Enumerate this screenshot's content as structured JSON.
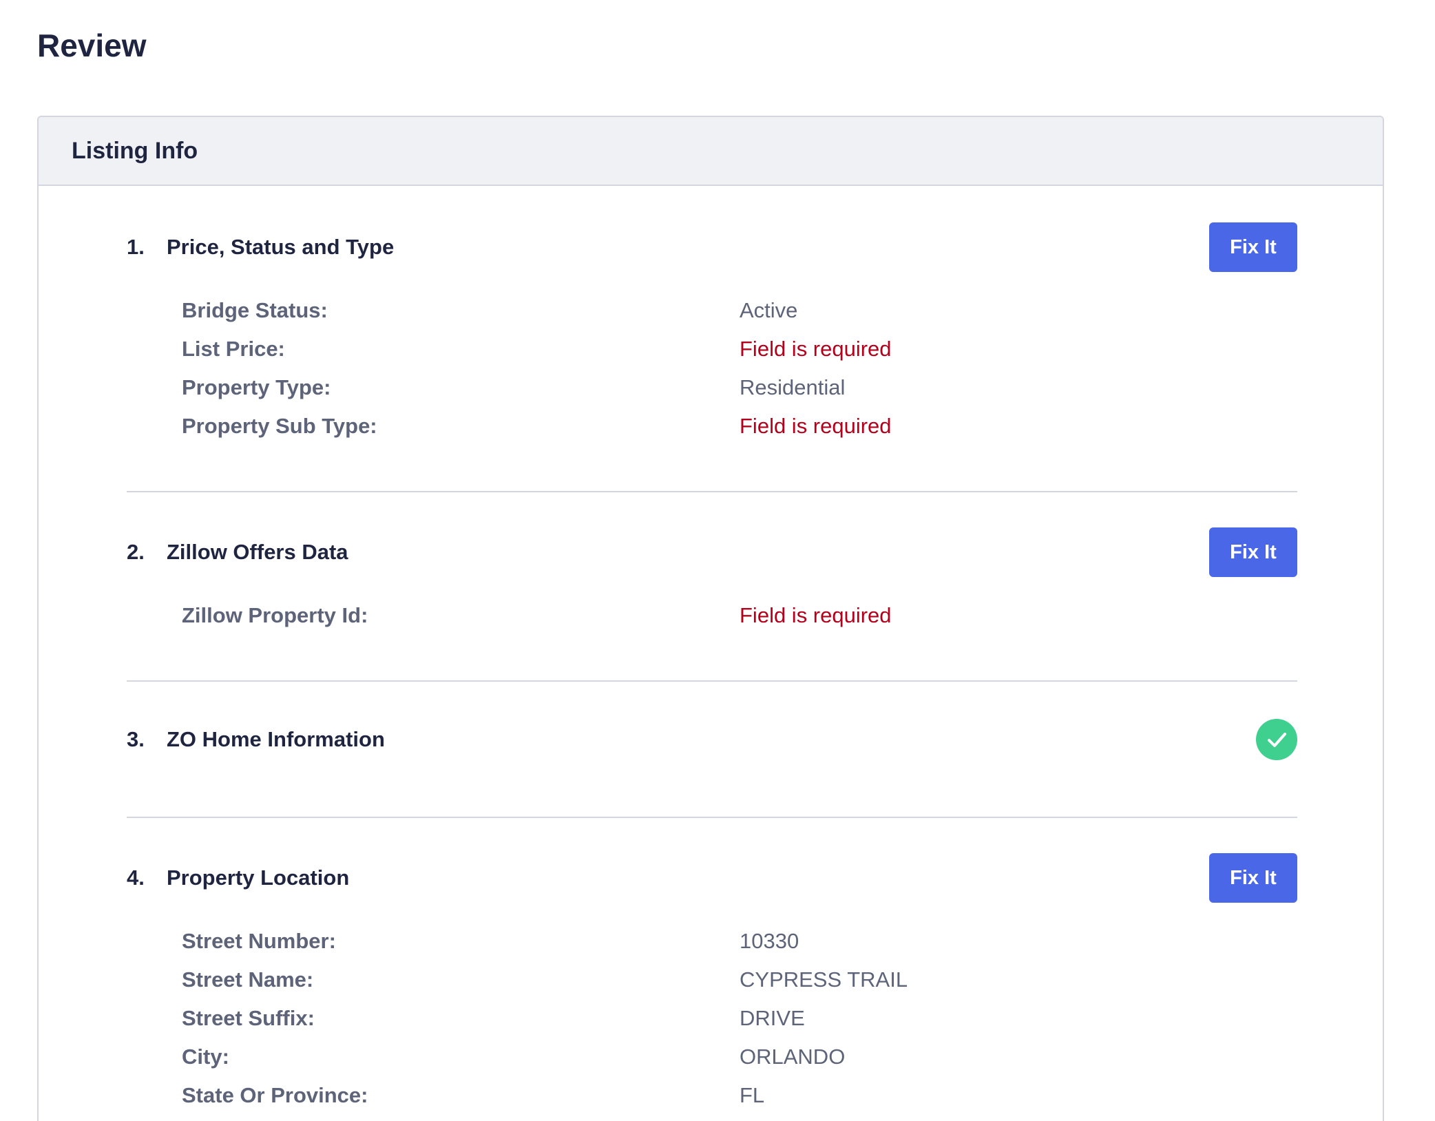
{
  "page": {
    "title": "Review"
  },
  "card": {
    "title": "Listing Info"
  },
  "colors": {
    "primary_button": "#4a67e8",
    "error_text": "#b3001b",
    "success": "#3fcf8e",
    "header_bg": "#f0f1f4"
  },
  "sections": [
    {
      "number": "1.",
      "title": "Price, Status and Type",
      "action_label": "Fix It",
      "status": "needs-fix",
      "fields": [
        {
          "label": "Bridge Status:",
          "value": "Active",
          "error": false
        },
        {
          "label": "List Price:",
          "value": "Field is required",
          "error": true
        },
        {
          "label": "Property Type:",
          "value": "Residential",
          "error": false
        },
        {
          "label": "Property Sub Type:",
          "value": "Field is required",
          "error": true
        }
      ]
    },
    {
      "number": "2.",
      "title": "Zillow Offers Data",
      "action_label": "Fix It",
      "status": "needs-fix",
      "fields": [
        {
          "label": "Zillow Property Id:",
          "value": "Field is required",
          "error": true
        }
      ]
    },
    {
      "number": "3.",
      "title": "ZO Home Information",
      "status": "complete",
      "status_icon": "check-circle-icon",
      "fields": []
    },
    {
      "number": "4.",
      "title": "Property Location",
      "action_label": "Fix It",
      "status": "needs-fix",
      "fields": [
        {
          "label": "Street Number:",
          "value": "10330",
          "error": false
        },
        {
          "label": "Street Name:",
          "value": "CYPRESS TRAIL",
          "error": false
        },
        {
          "label": "Street Suffix:",
          "value": "DRIVE",
          "error": false
        },
        {
          "label": "City:",
          "value": "ORLANDO",
          "error": false
        },
        {
          "label": "State Or Province:",
          "value": "FL",
          "error": false
        }
      ]
    }
  ]
}
